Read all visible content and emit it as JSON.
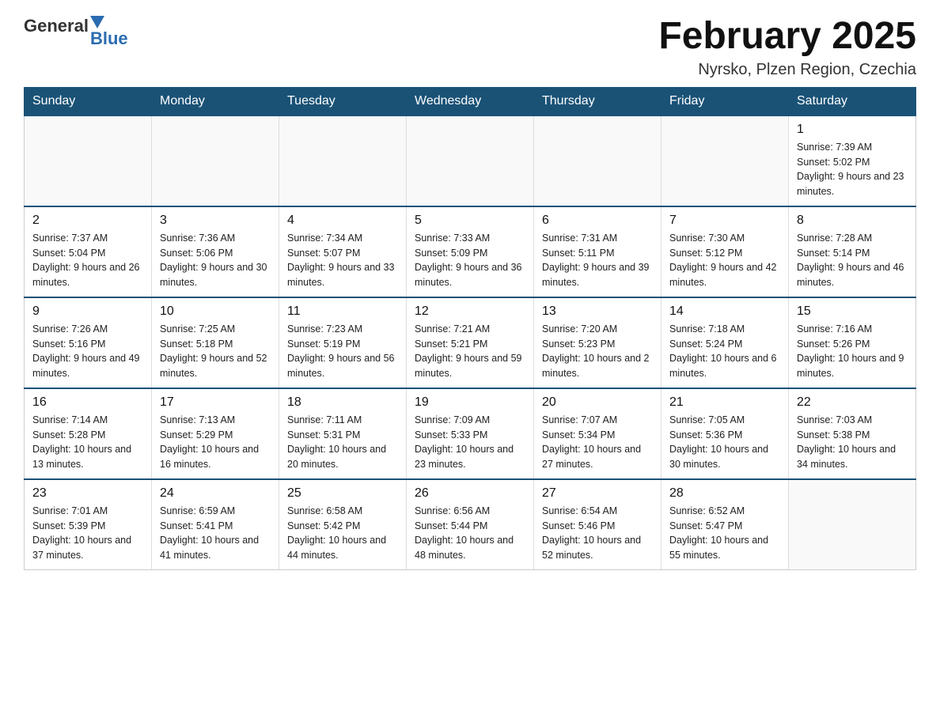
{
  "header": {
    "logo_general": "General",
    "logo_blue": "Blue",
    "month_title": "February 2025",
    "location": "Nyrsko, Plzen Region, Czechia"
  },
  "weekdays": [
    "Sunday",
    "Monday",
    "Tuesday",
    "Wednesday",
    "Thursday",
    "Friday",
    "Saturday"
  ],
  "weeks": [
    [
      {
        "day": "",
        "info": ""
      },
      {
        "day": "",
        "info": ""
      },
      {
        "day": "",
        "info": ""
      },
      {
        "day": "",
        "info": ""
      },
      {
        "day": "",
        "info": ""
      },
      {
        "day": "",
        "info": ""
      },
      {
        "day": "1",
        "info": "Sunrise: 7:39 AM\nSunset: 5:02 PM\nDaylight: 9 hours and 23 minutes."
      }
    ],
    [
      {
        "day": "2",
        "info": "Sunrise: 7:37 AM\nSunset: 5:04 PM\nDaylight: 9 hours and 26 minutes."
      },
      {
        "day": "3",
        "info": "Sunrise: 7:36 AM\nSunset: 5:06 PM\nDaylight: 9 hours and 30 minutes."
      },
      {
        "day": "4",
        "info": "Sunrise: 7:34 AM\nSunset: 5:07 PM\nDaylight: 9 hours and 33 minutes."
      },
      {
        "day": "5",
        "info": "Sunrise: 7:33 AM\nSunset: 5:09 PM\nDaylight: 9 hours and 36 minutes."
      },
      {
        "day": "6",
        "info": "Sunrise: 7:31 AM\nSunset: 5:11 PM\nDaylight: 9 hours and 39 minutes."
      },
      {
        "day": "7",
        "info": "Sunrise: 7:30 AM\nSunset: 5:12 PM\nDaylight: 9 hours and 42 minutes."
      },
      {
        "day": "8",
        "info": "Sunrise: 7:28 AM\nSunset: 5:14 PM\nDaylight: 9 hours and 46 minutes."
      }
    ],
    [
      {
        "day": "9",
        "info": "Sunrise: 7:26 AM\nSunset: 5:16 PM\nDaylight: 9 hours and 49 minutes."
      },
      {
        "day": "10",
        "info": "Sunrise: 7:25 AM\nSunset: 5:18 PM\nDaylight: 9 hours and 52 minutes."
      },
      {
        "day": "11",
        "info": "Sunrise: 7:23 AM\nSunset: 5:19 PM\nDaylight: 9 hours and 56 minutes."
      },
      {
        "day": "12",
        "info": "Sunrise: 7:21 AM\nSunset: 5:21 PM\nDaylight: 9 hours and 59 minutes."
      },
      {
        "day": "13",
        "info": "Sunrise: 7:20 AM\nSunset: 5:23 PM\nDaylight: 10 hours and 2 minutes."
      },
      {
        "day": "14",
        "info": "Sunrise: 7:18 AM\nSunset: 5:24 PM\nDaylight: 10 hours and 6 minutes."
      },
      {
        "day": "15",
        "info": "Sunrise: 7:16 AM\nSunset: 5:26 PM\nDaylight: 10 hours and 9 minutes."
      }
    ],
    [
      {
        "day": "16",
        "info": "Sunrise: 7:14 AM\nSunset: 5:28 PM\nDaylight: 10 hours and 13 minutes."
      },
      {
        "day": "17",
        "info": "Sunrise: 7:13 AM\nSunset: 5:29 PM\nDaylight: 10 hours and 16 minutes."
      },
      {
        "day": "18",
        "info": "Sunrise: 7:11 AM\nSunset: 5:31 PM\nDaylight: 10 hours and 20 minutes."
      },
      {
        "day": "19",
        "info": "Sunrise: 7:09 AM\nSunset: 5:33 PM\nDaylight: 10 hours and 23 minutes."
      },
      {
        "day": "20",
        "info": "Sunrise: 7:07 AM\nSunset: 5:34 PM\nDaylight: 10 hours and 27 minutes."
      },
      {
        "day": "21",
        "info": "Sunrise: 7:05 AM\nSunset: 5:36 PM\nDaylight: 10 hours and 30 minutes."
      },
      {
        "day": "22",
        "info": "Sunrise: 7:03 AM\nSunset: 5:38 PM\nDaylight: 10 hours and 34 minutes."
      }
    ],
    [
      {
        "day": "23",
        "info": "Sunrise: 7:01 AM\nSunset: 5:39 PM\nDaylight: 10 hours and 37 minutes."
      },
      {
        "day": "24",
        "info": "Sunrise: 6:59 AM\nSunset: 5:41 PM\nDaylight: 10 hours and 41 minutes."
      },
      {
        "day": "25",
        "info": "Sunrise: 6:58 AM\nSunset: 5:42 PM\nDaylight: 10 hours and 44 minutes."
      },
      {
        "day": "26",
        "info": "Sunrise: 6:56 AM\nSunset: 5:44 PM\nDaylight: 10 hours and 48 minutes."
      },
      {
        "day": "27",
        "info": "Sunrise: 6:54 AM\nSunset: 5:46 PM\nDaylight: 10 hours and 52 minutes."
      },
      {
        "day": "28",
        "info": "Sunrise: 6:52 AM\nSunset: 5:47 PM\nDaylight: 10 hours and 55 minutes."
      },
      {
        "day": "",
        "info": ""
      }
    ]
  ]
}
